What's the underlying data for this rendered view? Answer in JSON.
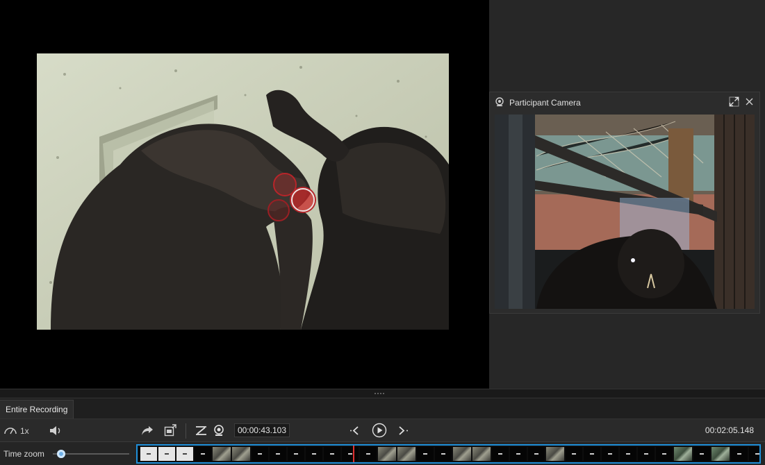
{
  "participant_camera": {
    "title": "Participant Camera"
  },
  "tabs": [
    {
      "label": "Entire Recording"
    }
  ],
  "controls": {
    "playback_speed": "1x",
    "current_time": "00:00:43.103",
    "total_time": "00:02:05.148"
  },
  "timeline": {
    "time_zoom_label": "Time zoom",
    "time_zoom_level": 0.05,
    "frames": [
      "white",
      "white",
      "white",
      "black",
      "img",
      "img",
      "black",
      "black",
      "black",
      "black",
      "black",
      "black",
      "black",
      "img",
      "img",
      "black",
      "black",
      "img",
      "img",
      "black",
      "black",
      "black",
      "img",
      "black",
      "black",
      "black",
      "black",
      "black",
      "black",
      "img-green",
      "black",
      "img-green",
      "black",
      "black",
      "img",
      "img"
    ]
  },
  "gaze_points": [
    {
      "label": "gaze-1",
      "emphasis": "faded"
    },
    {
      "label": "gaze-2",
      "emphasis": "active"
    },
    {
      "label": "gaze-3",
      "emphasis": "faded"
    }
  ],
  "colors": {
    "accent": "#1f8fd9",
    "gaze": "#c0282c",
    "playhead": "#e03030",
    "zoom_thumb": "#6fb0e8"
  },
  "icons": {
    "speed": "speedometer-icon",
    "volume": "speaker-icon",
    "share": "share-arrow-icon",
    "export": "export-snapshot-icon",
    "gaze_toggle": "gaze-toggle-icon",
    "camera_toggle": "webcam-icon",
    "prev": "previous-event-icon",
    "play": "play-icon",
    "next": "next-event-icon",
    "expand": "expand-icon",
    "close": "close-icon",
    "camera": "webcam-icon"
  }
}
